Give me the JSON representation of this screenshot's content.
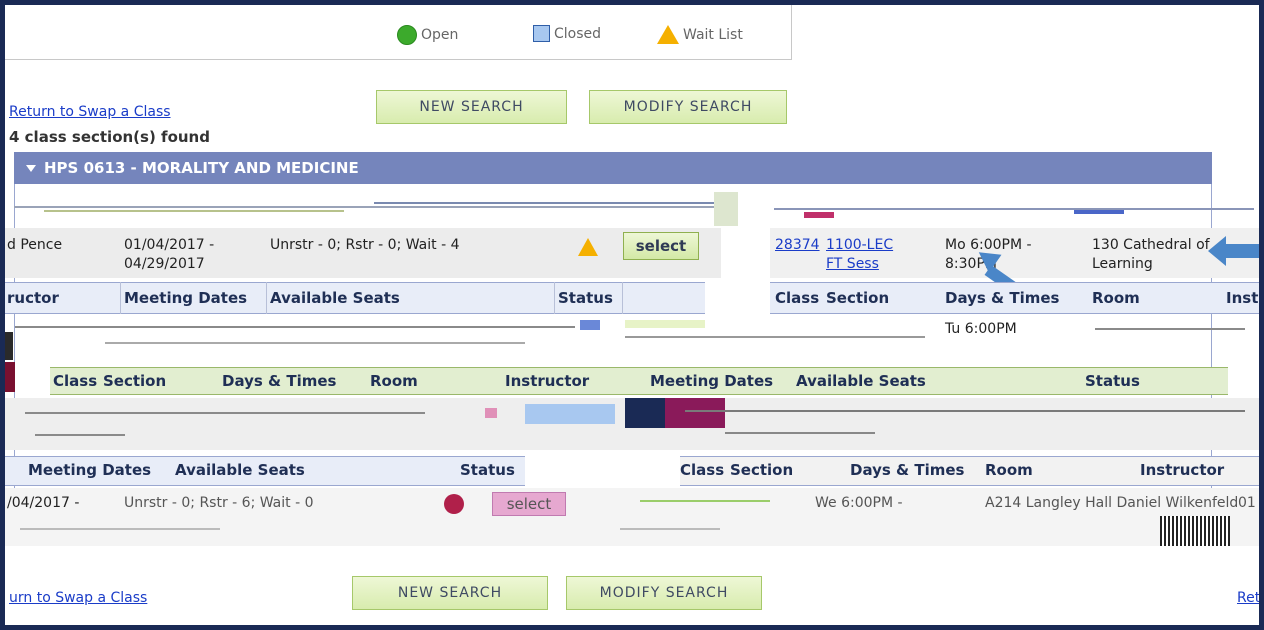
{
  "legend": {
    "open": "Open",
    "closed": "Closed",
    "wait": "Wait List"
  },
  "links": {
    "return_swap": "Return to Swap a Class",
    "return_swap_bottom": "urn to Swap a Class",
    "return_right": "Ret"
  },
  "buttons": {
    "new_search": "New Search",
    "modify_search": "Modify Search",
    "select": "select"
  },
  "results": {
    "found": "4 class section(s) found"
  },
  "course": {
    "title": "HPS 0613 - MORALITY AND MEDICINE"
  },
  "headers": {
    "instructor": "ructor",
    "meeting_dates": "Meeting Dates",
    "available_seats": "Available Seats",
    "status": "Status",
    "class": "Class",
    "section": "Section",
    "days_times": "Days & Times",
    "room": "Room",
    "inst": "Inst",
    "instructor_full": "Instructor",
    "status_short": "Status",
    "meeting_dates_b": "Meeting Dates",
    "available_seats_b": "Available Seats",
    "class_b": "Class",
    "section_b": "Section",
    "days_times_b": "Days & Times",
    "room_b": "Room",
    "instructor_b": "Instructor"
  },
  "row1": {
    "instructor": "d Pence",
    "dates_line1": "01/04/2017 -",
    "dates_line2": "04/29/2017",
    "seats": "Unrstr - 0; Rstr - 0; Wait - 4",
    "class_nbr": "28374",
    "section_line1": "1100-LEC",
    "section_line2": "FT Sess",
    "days_line1": "Mo 6:00PM -",
    "days_line2": "8:30PM",
    "room_line1": "130 Cathedral of",
    "room_line2": "Learning"
  },
  "row_partial": {
    "days": "Tu 6:00PM"
  },
  "row_bottom": {
    "dates": "/04/2017 -",
    "seats": "Unrstr - 0; Rstr - 6; Wait - 0",
    "days": "We 6:00PM -",
    "room_instr": "A214 Langley Hall  Daniel Wilkenfeld",
    "tail": "01"
  },
  "colors": {
    "bar": "#7585bc",
    "frame": "#1a2a55",
    "link": "#1a3cc8",
    "button": "#d8ecae",
    "arrow": "#4a86c8"
  }
}
